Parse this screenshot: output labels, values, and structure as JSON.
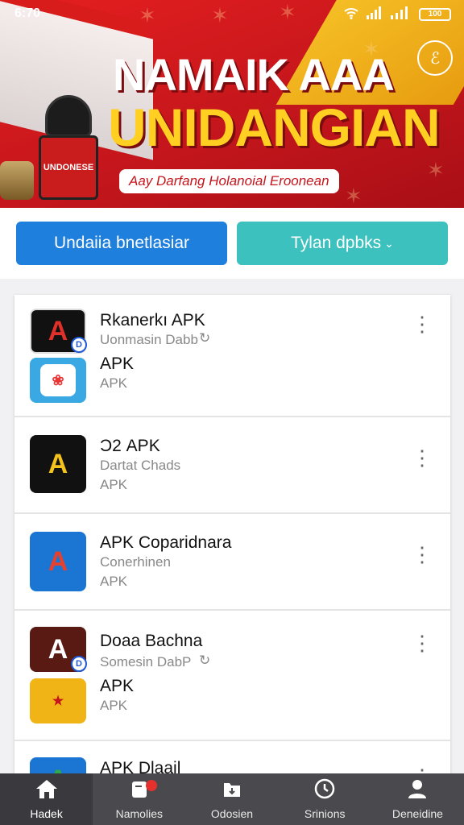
{
  "status_bar": {
    "time": "6:70",
    "battery": "100"
  },
  "banner": {
    "title_line1": "NAMAIK AAA",
    "title_line2": "UNIDANGIAN",
    "tagline": "Aay Darfang Holanoial Eroonean",
    "product_label": "UNDONESE"
  },
  "buttons": {
    "left_label": "Undaiia bnetlasiar",
    "right_label": "Tylan dpbks"
  },
  "apps": [
    {
      "name": "Rkanerkı APK",
      "sub": "Uonmasin Dabb",
      "name2": "APK",
      "sub2": "APK"
    },
    {
      "name": "Ͻ2 APK",
      "sub": "Dartat Chads",
      "sub2": "APK"
    },
    {
      "name": "APK Coparidnara",
      "sub": "Conerhinen",
      "sub2": "APK"
    },
    {
      "name": "Doaa Bachna",
      "sub": "Somesin DabP",
      "name2": "APK",
      "sub2": "APK"
    },
    {
      "name": "APK Dlaail"
    }
  ],
  "nav": [
    {
      "label": "Hadek",
      "icon": "home-icon"
    },
    {
      "label": "Namolies",
      "icon": "notifications-icon"
    },
    {
      "label": "Odosien",
      "icon": "downloads-icon"
    },
    {
      "label": "Srinions",
      "icon": "clock-icon"
    },
    {
      "label": "Deneidine",
      "icon": "profile-icon"
    }
  ],
  "colors": {
    "primary_blue": "#1f7fdc",
    "teal": "#3cc1bf",
    "banner_red": "#c4161c",
    "gold": "#ffcf22"
  }
}
